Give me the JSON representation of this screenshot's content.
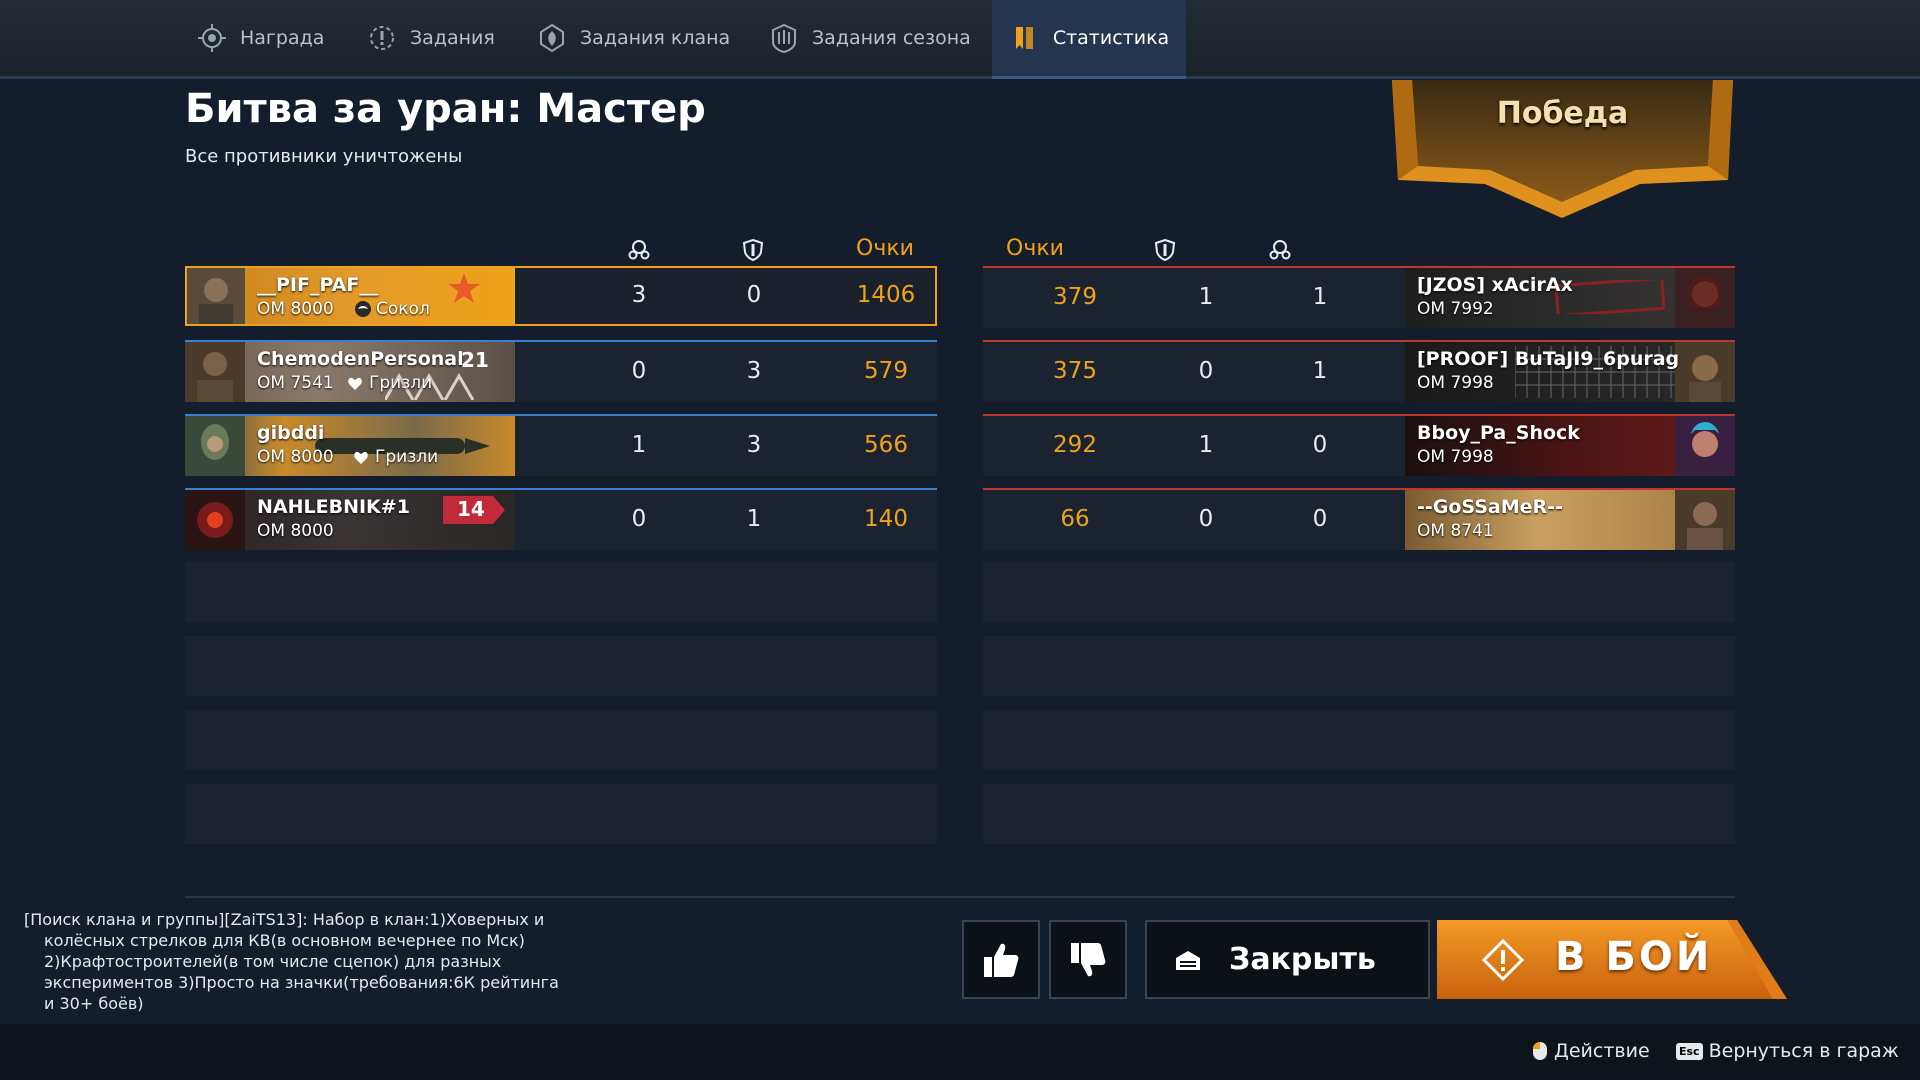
{
  "tabs": [
    {
      "label": "Награда",
      "icon": "reward-icon"
    },
    {
      "label": "Задания",
      "icon": "tasks-icon"
    },
    {
      "label": "Задания клана",
      "icon": "clan-tasks-icon"
    },
    {
      "label": "Задания сезона",
      "icon": "season-tasks-icon"
    },
    {
      "label": "Статистика",
      "icon": "stats-icon",
      "active": true
    }
  ],
  "battle": {
    "title": "Битва за уран: Мастер",
    "subtitle": "Все противники уничтожены",
    "result": "Победа"
  },
  "columns": {
    "points": "Очки",
    "kills_icon": "skull-icon",
    "assists_icon": "shield-icon"
  },
  "team_left": [
    {
      "name": "__PIF_PAF__",
      "om": "ОМ 8000",
      "clan": "Сокол",
      "level": "",
      "kills": "3",
      "assists": "0",
      "points": "1406"
    },
    {
      "name": "ChemodenPersonal",
      "om": "ОМ 7541",
      "clan": "Гризли",
      "level": "21",
      "kills": "0",
      "assists": "3",
      "points": "579"
    },
    {
      "name": "gibddi",
      "om": "ОМ 8000",
      "clan": "Гризли",
      "level": "",
      "kills": "1",
      "assists": "3",
      "points": "566"
    },
    {
      "name": "NAHLEBNIK#1",
      "om": "ОМ 8000",
      "clan": "",
      "level": "14",
      "kills": "0",
      "assists": "1",
      "points": "140"
    }
  ],
  "team_right": [
    {
      "name": "[JZOS] xAcirAx",
      "om": "ОМ 7992",
      "points": "379",
      "assists": "1",
      "kills": "1"
    },
    {
      "name": "[PROOF] BuTaJI9_6purag",
      "om": "ОМ 7998",
      "points": "375",
      "assists": "0",
      "kills": "1"
    },
    {
      "name": "Bboy_Pa_Shock",
      "om": "ОМ 7998",
      "points": "292",
      "assists": "1",
      "kills": "0"
    },
    {
      "name": "--GoSSaMeR--",
      "om": "ОМ 8741",
      "points": "66",
      "assists": "0",
      "kills": "0"
    }
  ],
  "chat": {
    "line1": "[Поиск клана и группы][ZaiTS13]: Набор в клан:1)Ховерных и",
    "line2": "колёсных стрелков для КВ(в основном вечернее по Мск)",
    "line3": "2)Крафтостроителей(в том числе сцепок) для разных",
    "line4": "экспериментов 3)Просто на значки(требования:6К рейтинга",
    "line5": "и 30+ боёв)"
  },
  "buttons": {
    "close": "Закрыть",
    "fight": "В БОЙ"
  },
  "hints": {
    "action": "Действие",
    "esc_key": "Esc",
    "back": "Вернуться в гараж"
  },
  "colors": {
    "accent": "#f0a21a",
    "ally_line": "#3a7fd0",
    "enemy_line": "#c0352c",
    "background": "#141d2b"
  }
}
